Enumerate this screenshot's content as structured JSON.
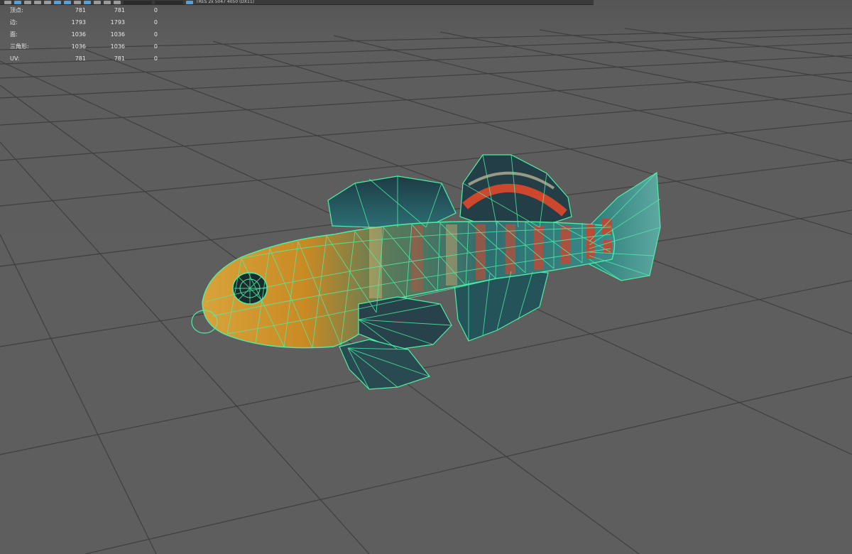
{
  "toolbar": {
    "status_readout": "TRES 2x 5047 4050 (DX11)"
  },
  "hud": {
    "rows": [
      {
        "label": "顶点:",
        "total": "781",
        "selected": "781",
        "extra": "0"
      },
      {
        "label": "边:",
        "total": "1793",
        "selected": "1793",
        "extra": "0"
      },
      {
        "label": "面:",
        "total": "1036",
        "selected": "1036",
        "extra": "0"
      },
      {
        "label": "三角形:",
        "total": "1036",
        "selected": "1036",
        "extra": "0"
      },
      {
        "label": "UV:",
        "total": "781",
        "selected": "781",
        "extra": "0"
      }
    ]
  },
  "viewport": {
    "background_color": "#5c5c5c",
    "grid_color": "#3e3e3e",
    "wireframe_color": "#4cf0a4",
    "model": "textured fish mesh with wireframe overlay"
  }
}
